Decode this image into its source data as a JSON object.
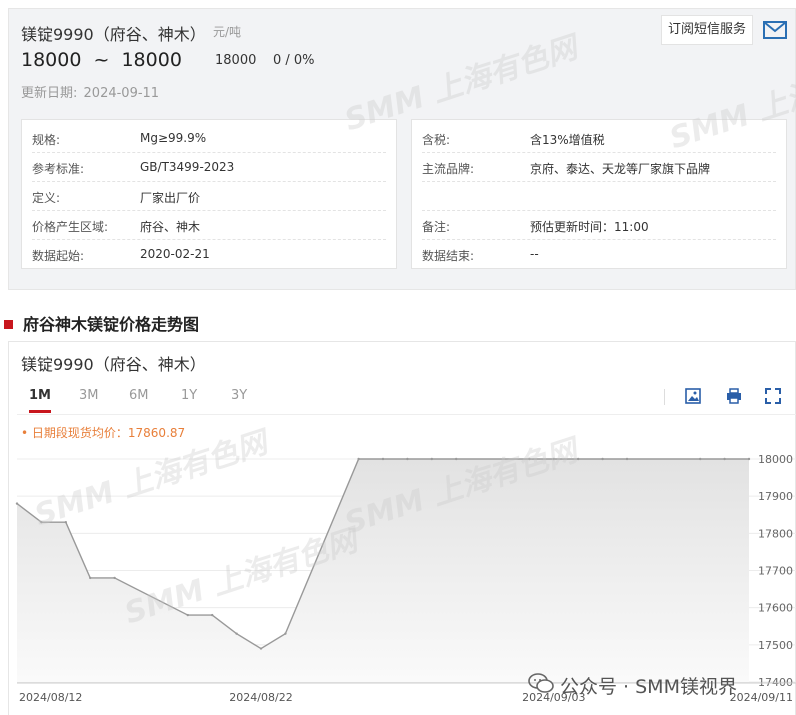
{
  "header": {
    "title": "镁锭9990（府谷、神木）",
    "unit": "元/吨",
    "price_low": "18000",
    "price_sep": "~",
    "price_high": "18000",
    "price_avg": "18000",
    "change": "0 / 0%",
    "update_label": "更新日期:",
    "update_date": "2024-09-11",
    "subscribe_label": "订阅短信服务",
    "mail_icon": "mail-icon"
  },
  "info_left": [
    {
      "key": "规格:",
      "value": "Mg≥99.9%"
    },
    {
      "key": "参考标准:",
      "value": "GB/T3499-2023"
    },
    {
      "key": "定义:",
      "value": "厂家出厂价"
    },
    {
      "key": "价格产生区域:",
      "value": "府谷、神木"
    },
    {
      "key": "数据起始:",
      "value": "2020-02-21"
    }
  ],
  "info_right": [
    {
      "key": "含税:",
      "value": "含13%增值税"
    },
    {
      "key": "主流品牌:",
      "value": "京府、泰达、天龙等厂家旗下品牌"
    },
    {
      "key": "",
      "value": ""
    },
    {
      "key": "备注:",
      "value": "预估更新时间：11:00"
    },
    {
      "key": "数据结束:",
      "value": "--"
    }
  ],
  "section": {
    "title": "府谷神木镁锭价格走势图"
  },
  "chart_panel": {
    "title": "镁锭9990（府谷、神木）",
    "tabs": [
      "1M",
      "3M",
      "6M",
      "1Y",
      "3Y"
    ],
    "active_tab": "1M",
    "avg_text": "• 日期段现货均价：17860.87",
    "tools": [
      "download-image-icon",
      "print-icon",
      "fullscreen-icon"
    ]
  },
  "watermark_text": "SMM 上海有色网",
  "footer": {
    "credit": "公众号 · SMM镁视界",
    "icon": "wechat-icon"
  },
  "chart_data": {
    "type": "area",
    "title": "",
    "xlabel": "",
    "ylabel": "",
    "x_ticks": [
      "2024/08/12",
      "2024/08/22",
      "2024/09/03",
      "2024/09/11"
    ],
    "y_ticks": [
      17400,
      17500,
      17600,
      17700,
      17800,
      17900,
      18000
    ],
    "ylim": [
      17400,
      18000
    ],
    "grid": true,
    "series": [
      {
        "name": "",
        "x": [
          "2024-08-12",
          "2024-08-13",
          "2024-08-14",
          "2024-08-15",
          "2024-08-16",
          "2024-08-19",
          "2024-08-20",
          "2024-08-21",
          "2024-08-22",
          "2024-08-23",
          "2024-08-26",
          "2024-08-27",
          "2024-08-28",
          "2024-08-29",
          "2024-08-30",
          "2024-09-02",
          "2024-09-03",
          "2024-09-04",
          "2024-09-05",
          "2024-09-06",
          "2024-09-09",
          "2024-09-10",
          "2024-09-11"
        ],
        "values": [
          17880,
          17830,
          17830,
          17680,
          17680,
          17580,
          17580,
          17530,
          17490,
          17530,
          18000,
          18000,
          18000,
          18000,
          18000,
          18000,
          18000,
          18000,
          18000,
          18000,
          18000,
          18000,
          18000
        ]
      }
    ]
  }
}
